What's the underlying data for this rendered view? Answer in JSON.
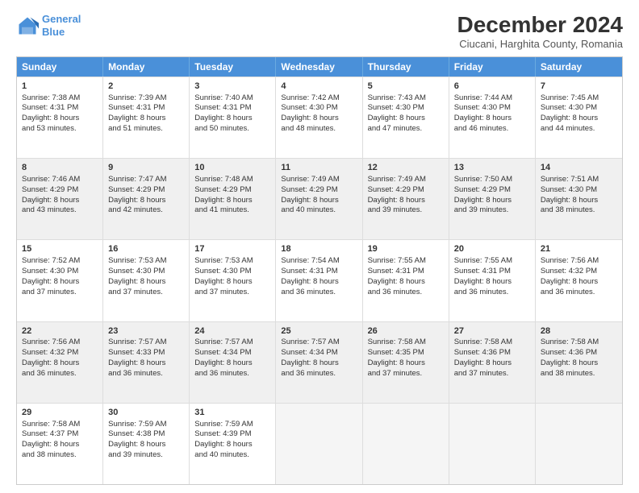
{
  "logo": {
    "line1": "General",
    "line2": "Blue"
  },
  "title": "December 2024",
  "subtitle": "Ciucani, Harghita County, Romania",
  "header_days": [
    "Sunday",
    "Monday",
    "Tuesday",
    "Wednesday",
    "Thursday",
    "Friday",
    "Saturday"
  ],
  "weeks": [
    [
      {
        "day": "1",
        "lines": [
          "Sunrise: 7:38 AM",
          "Sunset: 4:31 PM",
          "Daylight: 8 hours",
          "and 53 minutes."
        ],
        "shade": false
      },
      {
        "day": "2",
        "lines": [
          "Sunrise: 7:39 AM",
          "Sunset: 4:31 PM",
          "Daylight: 8 hours",
          "and 51 minutes."
        ],
        "shade": false
      },
      {
        "day": "3",
        "lines": [
          "Sunrise: 7:40 AM",
          "Sunset: 4:31 PM",
          "Daylight: 8 hours",
          "and 50 minutes."
        ],
        "shade": false
      },
      {
        "day": "4",
        "lines": [
          "Sunrise: 7:42 AM",
          "Sunset: 4:30 PM",
          "Daylight: 8 hours",
          "and 48 minutes."
        ],
        "shade": false
      },
      {
        "day": "5",
        "lines": [
          "Sunrise: 7:43 AM",
          "Sunset: 4:30 PM",
          "Daylight: 8 hours",
          "and 47 minutes."
        ],
        "shade": false
      },
      {
        "day": "6",
        "lines": [
          "Sunrise: 7:44 AM",
          "Sunset: 4:30 PM",
          "Daylight: 8 hours",
          "and 46 minutes."
        ],
        "shade": false
      },
      {
        "day": "7",
        "lines": [
          "Sunrise: 7:45 AM",
          "Sunset: 4:30 PM",
          "Daylight: 8 hours",
          "and 44 minutes."
        ],
        "shade": false
      }
    ],
    [
      {
        "day": "8",
        "lines": [
          "Sunrise: 7:46 AM",
          "Sunset: 4:29 PM",
          "Daylight: 8 hours",
          "and 43 minutes."
        ],
        "shade": true
      },
      {
        "day": "9",
        "lines": [
          "Sunrise: 7:47 AM",
          "Sunset: 4:29 PM",
          "Daylight: 8 hours",
          "and 42 minutes."
        ],
        "shade": true
      },
      {
        "day": "10",
        "lines": [
          "Sunrise: 7:48 AM",
          "Sunset: 4:29 PM",
          "Daylight: 8 hours",
          "and 41 minutes."
        ],
        "shade": true
      },
      {
        "day": "11",
        "lines": [
          "Sunrise: 7:49 AM",
          "Sunset: 4:29 PM",
          "Daylight: 8 hours",
          "and 40 minutes."
        ],
        "shade": true
      },
      {
        "day": "12",
        "lines": [
          "Sunrise: 7:49 AM",
          "Sunset: 4:29 PM",
          "Daylight: 8 hours",
          "and 39 minutes."
        ],
        "shade": true
      },
      {
        "day": "13",
        "lines": [
          "Sunrise: 7:50 AM",
          "Sunset: 4:29 PM",
          "Daylight: 8 hours",
          "and 39 minutes."
        ],
        "shade": true
      },
      {
        "day": "14",
        "lines": [
          "Sunrise: 7:51 AM",
          "Sunset: 4:30 PM",
          "Daylight: 8 hours",
          "and 38 minutes."
        ],
        "shade": true
      }
    ],
    [
      {
        "day": "15",
        "lines": [
          "Sunrise: 7:52 AM",
          "Sunset: 4:30 PM",
          "Daylight: 8 hours",
          "and 37 minutes."
        ],
        "shade": false
      },
      {
        "day": "16",
        "lines": [
          "Sunrise: 7:53 AM",
          "Sunset: 4:30 PM",
          "Daylight: 8 hours",
          "and 37 minutes."
        ],
        "shade": false
      },
      {
        "day": "17",
        "lines": [
          "Sunrise: 7:53 AM",
          "Sunset: 4:30 PM",
          "Daylight: 8 hours",
          "and 37 minutes."
        ],
        "shade": false
      },
      {
        "day": "18",
        "lines": [
          "Sunrise: 7:54 AM",
          "Sunset: 4:31 PM",
          "Daylight: 8 hours",
          "and 36 minutes."
        ],
        "shade": false
      },
      {
        "day": "19",
        "lines": [
          "Sunrise: 7:55 AM",
          "Sunset: 4:31 PM",
          "Daylight: 8 hours",
          "and 36 minutes."
        ],
        "shade": false
      },
      {
        "day": "20",
        "lines": [
          "Sunrise: 7:55 AM",
          "Sunset: 4:31 PM",
          "Daylight: 8 hours",
          "and 36 minutes."
        ],
        "shade": false
      },
      {
        "day": "21",
        "lines": [
          "Sunrise: 7:56 AM",
          "Sunset: 4:32 PM",
          "Daylight: 8 hours",
          "and 36 minutes."
        ],
        "shade": false
      }
    ],
    [
      {
        "day": "22",
        "lines": [
          "Sunrise: 7:56 AM",
          "Sunset: 4:32 PM",
          "Daylight: 8 hours",
          "and 36 minutes."
        ],
        "shade": true
      },
      {
        "day": "23",
        "lines": [
          "Sunrise: 7:57 AM",
          "Sunset: 4:33 PM",
          "Daylight: 8 hours",
          "and 36 minutes."
        ],
        "shade": true
      },
      {
        "day": "24",
        "lines": [
          "Sunrise: 7:57 AM",
          "Sunset: 4:34 PM",
          "Daylight: 8 hours",
          "and 36 minutes."
        ],
        "shade": true
      },
      {
        "day": "25",
        "lines": [
          "Sunrise: 7:57 AM",
          "Sunset: 4:34 PM",
          "Daylight: 8 hours",
          "and 36 minutes."
        ],
        "shade": true
      },
      {
        "day": "26",
        "lines": [
          "Sunrise: 7:58 AM",
          "Sunset: 4:35 PM",
          "Daylight: 8 hours",
          "and 37 minutes."
        ],
        "shade": true
      },
      {
        "day": "27",
        "lines": [
          "Sunrise: 7:58 AM",
          "Sunset: 4:36 PM",
          "Daylight: 8 hours",
          "and 37 minutes."
        ],
        "shade": true
      },
      {
        "day": "28",
        "lines": [
          "Sunrise: 7:58 AM",
          "Sunset: 4:36 PM",
          "Daylight: 8 hours",
          "and 38 minutes."
        ],
        "shade": true
      }
    ],
    [
      {
        "day": "29",
        "lines": [
          "Sunrise: 7:58 AM",
          "Sunset: 4:37 PM",
          "Daylight: 8 hours",
          "and 38 minutes."
        ],
        "shade": false
      },
      {
        "day": "30",
        "lines": [
          "Sunrise: 7:59 AM",
          "Sunset: 4:38 PM",
          "Daylight: 8 hours",
          "and 39 minutes."
        ],
        "shade": false
      },
      {
        "day": "31",
        "lines": [
          "Sunrise: 7:59 AM",
          "Sunset: 4:39 PM",
          "Daylight: 8 hours",
          "and 40 minutes."
        ],
        "shade": false
      },
      {
        "day": "",
        "lines": [],
        "shade": false,
        "empty": true
      },
      {
        "day": "",
        "lines": [],
        "shade": false,
        "empty": true
      },
      {
        "day": "",
        "lines": [],
        "shade": false,
        "empty": true
      },
      {
        "day": "",
        "lines": [],
        "shade": false,
        "empty": true
      }
    ]
  ]
}
